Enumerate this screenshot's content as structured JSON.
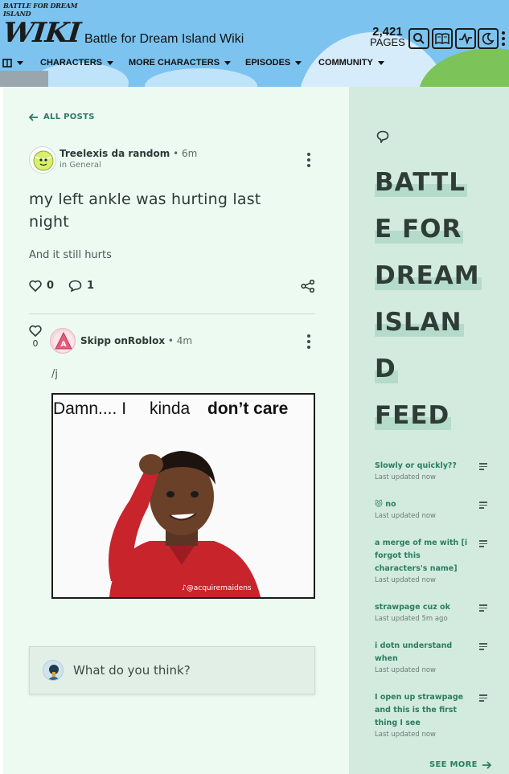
{
  "header": {
    "logo_small": "BATTLE FOR DREAM ISLAND",
    "logo_big": "WIKI",
    "site_title": "Battle for Dream Island Wiki",
    "pages_count": "2,421",
    "pages_label": "PAGES",
    "nav": [
      {
        "label": "CHARACTERS"
      },
      {
        "label": "MORE CHARACTERS"
      },
      {
        "label": "EPISODES"
      },
      {
        "label": "COMMUNITY"
      }
    ]
  },
  "post": {
    "back_label": "ALL POSTS",
    "author": "Treelexis da random",
    "time": "6m",
    "category_prefix": "in",
    "category": "General",
    "title": "my left ankle was hurting last night",
    "body": "And it still hurts",
    "likes": "0",
    "replies": "1"
  },
  "reply": {
    "likes": "0",
    "author": "Skipp onRoblox",
    "time": "4m",
    "text": "/j",
    "image": {
      "caption_part1": "Damn.... I",
      "caption_part2": "kinda",
      "caption_part3": "don’t care",
      "watermark": "♪@acquiremaidens"
    }
  },
  "comment": {
    "placeholder": "What do you think?"
  },
  "sidebar": {
    "feed_title_lines": [
      "BATTL",
      "E FOR",
      "DREAM",
      "ISLAN",
      "D",
      "FEED"
    ],
    "items": [
      {
        "title": "Slowly or quickly??",
        "updated": "Last updated now"
      },
      {
        "title": "😾 no",
        "updated": "Last updated now"
      },
      {
        "title": "a merge of me with [i forgot this characters's name]",
        "updated": "Last updated now"
      },
      {
        "title": "strawpage cuz ok",
        "updated": "Last updated 5m ago"
      },
      {
        "title": "i dotn understand when",
        "updated": "Last updated now"
      },
      {
        "title": "I open up strawpage and this is the first thing I see",
        "updated": "Last updated now"
      }
    ],
    "see_more": "SEE MORE"
  },
  "colors": {
    "accent": "#2a7d5f",
    "main_bg": "#edfaf2",
    "sidebar_bg": "#d3ebdf",
    "header_bg": "#7cc4ef"
  }
}
